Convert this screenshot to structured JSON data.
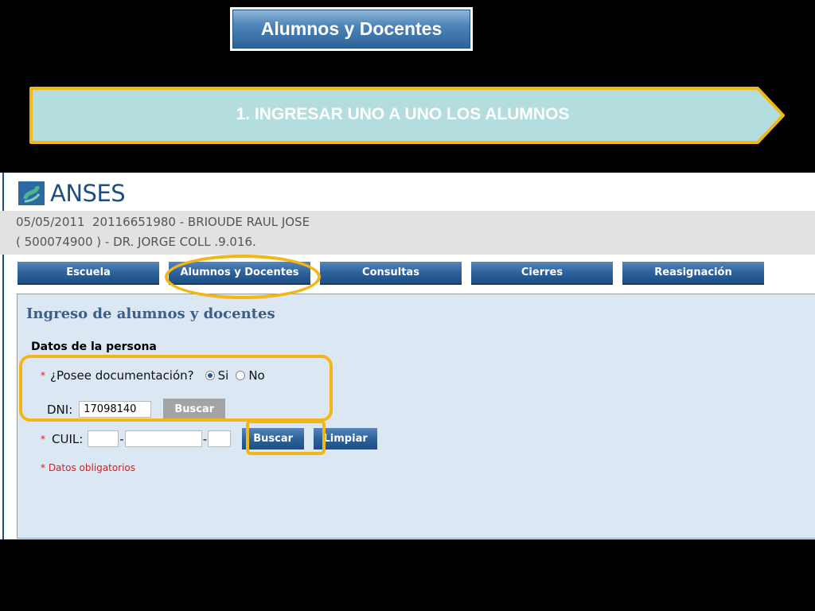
{
  "slide": {
    "title_button": "Alumnos y Docentes",
    "step_text": "1. INGRESAR UNO A UNO LOS ALUMNOS"
  },
  "colors": {
    "highlight": "#f2b616",
    "arrow_fill": "#b4dede",
    "tab_blue": "#2e629b",
    "panel_bg": "#dbe7f3"
  },
  "app": {
    "logo_text": "ANSES",
    "logo_icon": "anses-logo-icon",
    "info_line1": "05/05/2011  20116651980 - BRIOUDE RAUL JOSE",
    "info_line2": "( 500074900 ) - DR. JORGE COLL .9.016.",
    "tabs": [
      {
        "label": "Escuela"
      },
      {
        "label": "Alumnos y Docentes"
      },
      {
        "label": "Consultas"
      },
      {
        "label": "Cierres"
      },
      {
        "label": "Reasignación"
      }
    ]
  },
  "form": {
    "title": "Ingreso de alumnos y docentes",
    "section": "Datos de la persona",
    "doc_question": "¿Posee documentación?",
    "required_mark": "*",
    "radio_yes": "Si",
    "radio_no": "No",
    "radio_selected": "Si",
    "dni_label": "DNI:",
    "dni_value": "17098140",
    "dni_search_button": "Buscar",
    "cuil_label": "CUIL:",
    "cuil_sep": "-",
    "cuil_part1": "",
    "cuil_part2": "",
    "cuil_part3": "",
    "search_button": "Buscar",
    "clear_button": "Limpiar",
    "required_note": "* Datos obligatorios"
  }
}
